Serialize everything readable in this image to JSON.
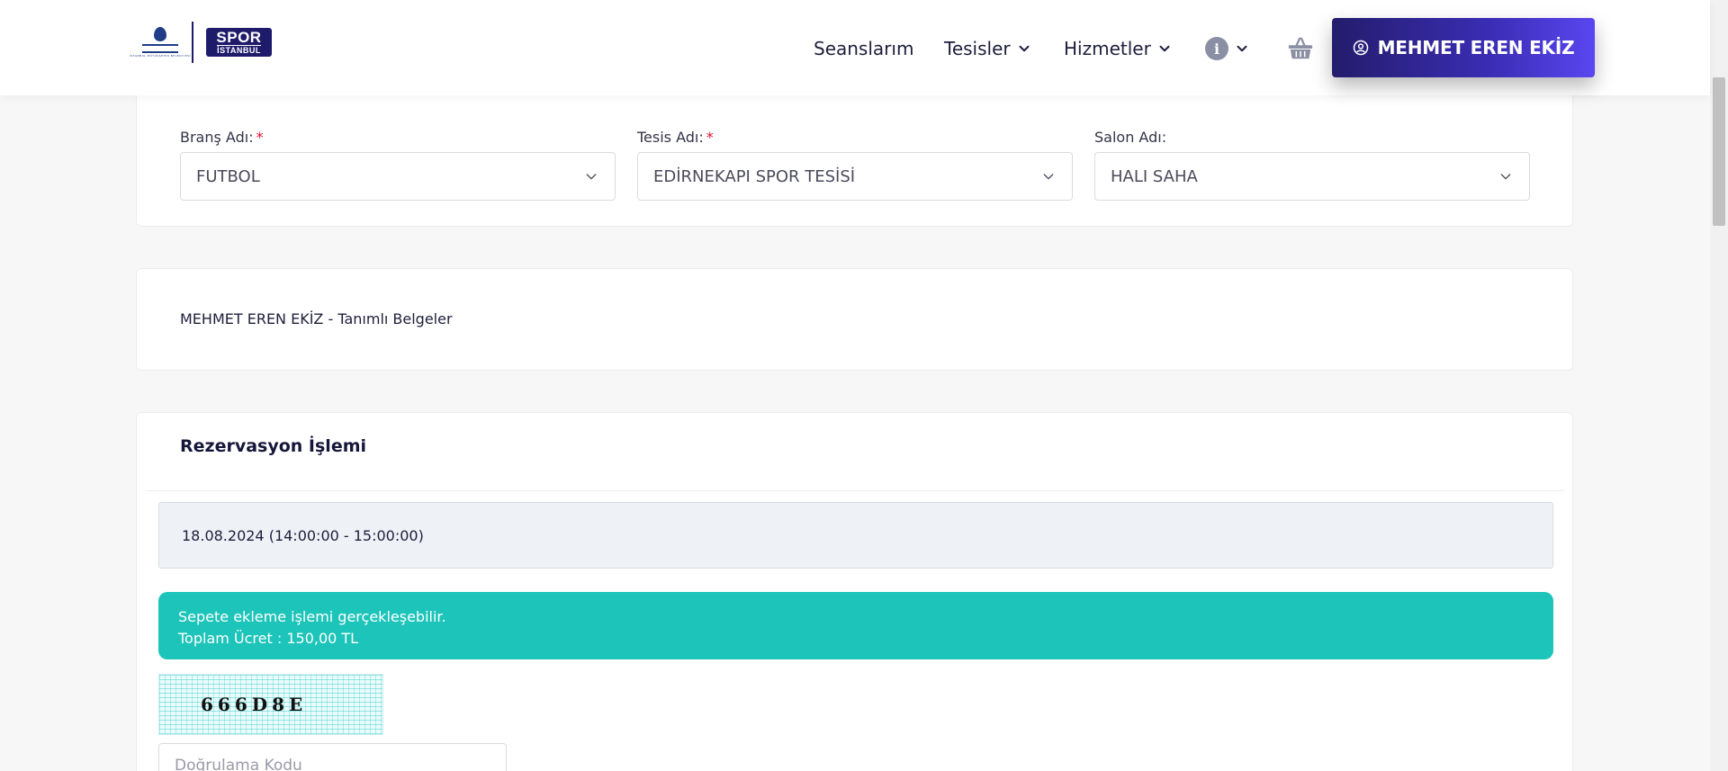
{
  "header": {
    "logo_ibb_small": "İSTANBUL BÜYÜKŞEHİR BELEDİYESİ",
    "logo_spor_line1": "SPOR",
    "logo_spor_line2": "İSTANBUL",
    "nav": {
      "seanslarim": "Seanslarım",
      "tesisler": "Tesisler",
      "hizmetler": "Hizmetler"
    },
    "user_button": "MEHMET EREN EKİZ"
  },
  "filters": {
    "brans": {
      "label": "Branş Adı:",
      "required": "*",
      "value": "FUTBOL"
    },
    "tesis": {
      "label": "Tesis Adı:",
      "required": "*",
      "value": "EDİRNEKAPI SPOR TESİSİ"
    },
    "salon": {
      "label": "Salon Adı:",
      "value": "HALI SAHA"
    }
  },
  "documents": {
    "title": "MEHMET EREN EKİZ - Tanımlı Belgeler"
  },
  "reservation": {
    "title": "Rezervasyon İşlemi",
    "slot": "18.08.2024 (14:00:00 - 15:00:00)",
    "alert_line1": "Sepete ekleme işlemi gerçekleşebilir.",
    "alert_line2": "Toplam Ücret : 150,00 TL",
    "captcha_text": "666D8E",
    "code_placeholder": "Doğrulama Kodu"
  },
  "colors": {
    "accent": "#2e2496",
    "alert_bg": "#1dc4b9",
    "required": "#e0102a"
  },
  "icons": [
    "chevron-down-icon",
    "info-icon",
    "basket-icon",
    "user-circle-icon"
  ]
}
